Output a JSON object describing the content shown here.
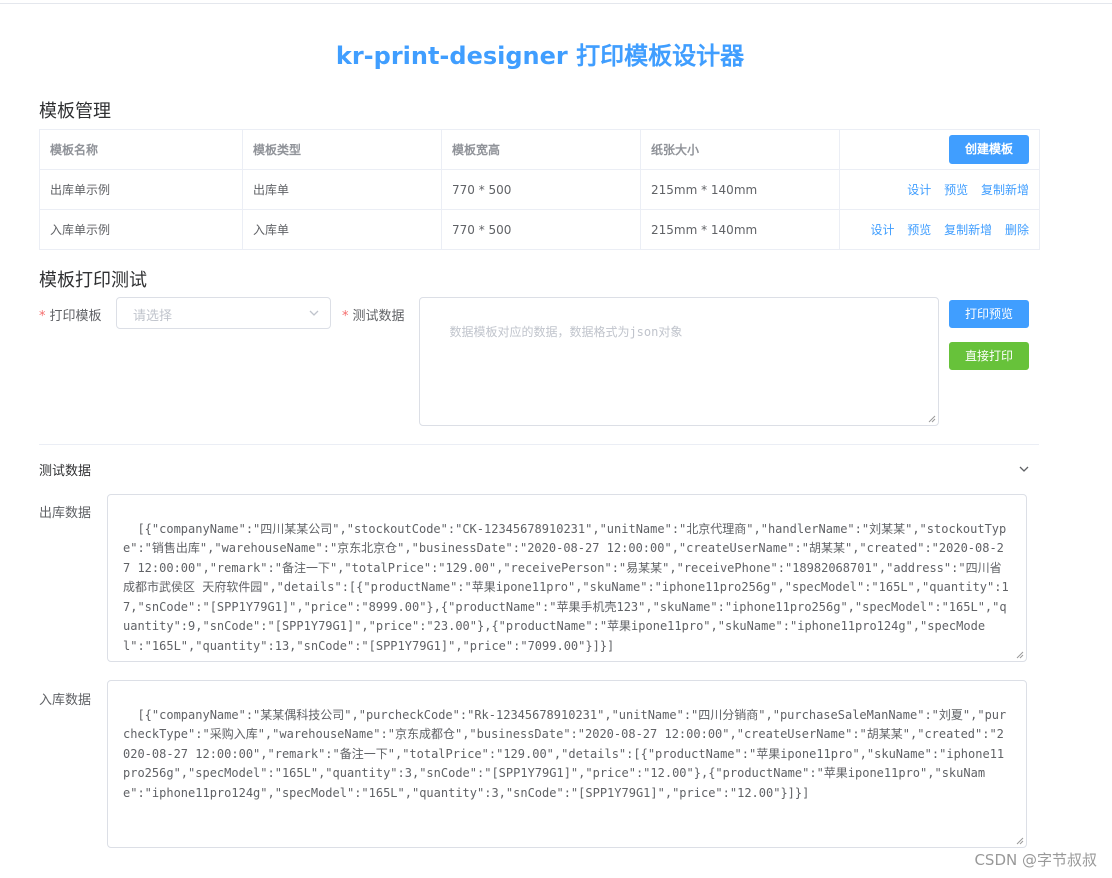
{
  "app": {
    "title": "kr-print-designer 打印模板设计器"
  },
  "template_management": {
    "title": "模板管理",
    "columns": [
      "模板名称",
      "模板类型",
      "模板宽高",
      "纸张大小"
    ],
    "create_button": "创建模板",
    "rows": [
      {
        "name": "出库单示例",
        "type": "出库单",
        "size": "770 * 500",
        "paper": "215mm * 140mm",
        "actions": [
          "设计",
          "预览",
          "复制新增"
        ]
      },
      {
        "name": "入库单示例",
        "type": "入库单",
        "size": "770 * 500",
        "paper": "215mm * 140mm",
        "actions": [
          "设计",
          "预览",
          "复制新增",
          "删除"
        ]
      }
    ]
  },
  "print_test": {
    "title": "模板打印测试",
    "template_label": "打印模板",
    "template_placeholder": "请选择",
    "data_label": "测试数据",
    "data_placeholder": "数据模板对应的数据，数据格式为json对象",
    "preview_button": "打印预览",
    "print_button": "直接打印",
    "required_mark": "*"
  },
  "test_data": {
    "title": "测试数据",
    "outbound_label": "出库数据",
    "outbound_json": "[{\"companyName\":\"四川某某公司\",\"stockoutCode\":\"CK-12345678910231\",\"unitName\":\"北京代理商\",\"handlerName\":\"刘某某\",\"stockoutType\":\"销售出库\",\"warehouseName\":\"京东北京仓\",\"businessDate\":\"2020-08-27 12:00:00\",\"createUserName\":\"胡某某\",\"created\":\"2020-08-27 12:00:00\",\"remark\":\"备注一下\",\"totalPrice\":\"129.00\",\"receivePerson\":\"易某某\",\"receivePhone\":\"18982068701\",\"address\":\"四川省成都市武侯区 天府软件园\",\"details\":[{\"productName\":\"苹果ipone11pro\",\"skuName\":\"iphone11pro256g\",\"specModel\":\"165L\",\"quantity\":17,\"snCode\":\"[SPP1Y79G1]\",\"price\":\"8999.00\"},{\"productName\":\"苹果手机壳123\",\"skuName\":\"iphone11pro256g\",\"specModel\":\"165L\",\"quantity\":9,\"snCode\":\"[SPP1Y79G1]\",\"price\":\"23.00\"},{\"productName\":\"苹果ipone11pro\",\"skuName\":\"iphone11pro124g\",\"specModel\":\"165L\",\"quantity\":13,\"snCode\":\"[SPP1Y79G1]\",\"price\":\"7099.00\"}]}]",
    "inbound_label": "入库数据",
    "inbound_json": "[{\"companyName\":\"某某偶科技公司\",\"purcheckCode\":\"Rk-12345678910231\",\"unitName\":\"四川分销商\",\"purchaseSaleManName\":\"刘夏\",\"purcheckType\":\"采购入库\",\"warehouseName\":\"京东成都仓\",\"businessDate\":\"2020-08-27 12:00:00\",\"createUserName\":\"胡某某\",\"created\":\"2020-08-27 12:00:00\",\"remark\":\"备注一下\",\"totalPrice\":\"129.00\",\"details\":[{\"productName\":\"苹果ipone11pro\",\"skuName\":\"iphone11pro256g\",\"specModel\":\"165L\",\"quantity\":3,\"snCode\":\"[SPP1Y79G1]\",\"price\":\"12.00\"},{\"productName\":\"苹果ipone11pro\",\"skuName\":\"iphone11pro124g\",\"specModel\":\"165L\",\"quantity\":3,\"snCode\":\"[SPP1Y79G1]\",\"price\":\"12.00\"}]}]"
  },
  "watermark": "CSDN @字节叔叔",
  "colors": {
    "primary": "#409eff",
    "success": "#67c23a",
    "danger": "#f56c6c"
  }
}
